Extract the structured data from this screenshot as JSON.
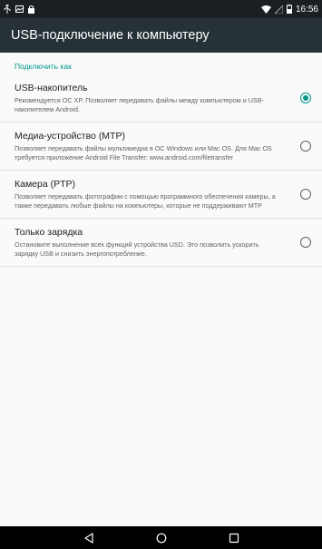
{
  "status_bar": {
    "time": "16:56",
    "left_icons": [
      "usb-icon",
      "image-notification-icon",
      "lock-notification-icon"
    ],
    "right_icons": [
      "wifi-icon",
      "no-signal-icon",
      "battery-icon"
    ]
  },
  "app_bar": {
    "title": "USB-подключение к компьютеру"
  },
  "section": {
    "header": "Подключить как"
  },
  "options": [
    {
      "title": "USB-накопитель",
      "description": "Рекомендуется ОС XP. Позволяет передавать файлы между компьютером и USB-накопителем Android.",
      "checked": true
    },
    {
      "title": "Медиа-устройство (MTP)",
      "description": "Позволяет передавать файлы мультимедиа в ОС Windows или Mac OS. Для Mac OS требуется приложение Android File Transfer: www.android.com/filetransfer",
      "checked": false
    },
    {
      "title": "Камера (PTP)",
      "description": "Позволяет передавать фотографии с помощью программного обеспечения камеры, а также передавать любые файлы на компьютеры, которые не поддерживают MTP",
      "checked": false
    },
    {
      "title": "Только зарядка",
      "description": "Остановите выполнение всех функций устройства USD. Это позволить ускорить зарядку USB и снизить энергопотребление.",
      "checked": false
    }
  ],
  "nav_bar": {
    "buttons": [
      "back-icon",
      "home-icon",
      "recents-icon"
    ]
  },
  "colors": {
    "status_bar": "#1a1f24",
    "app_bar": "#263238",
    "accent": "#009688",
    "background": "#fafafa",
    "nav_bar": "#000000"
  }
}
